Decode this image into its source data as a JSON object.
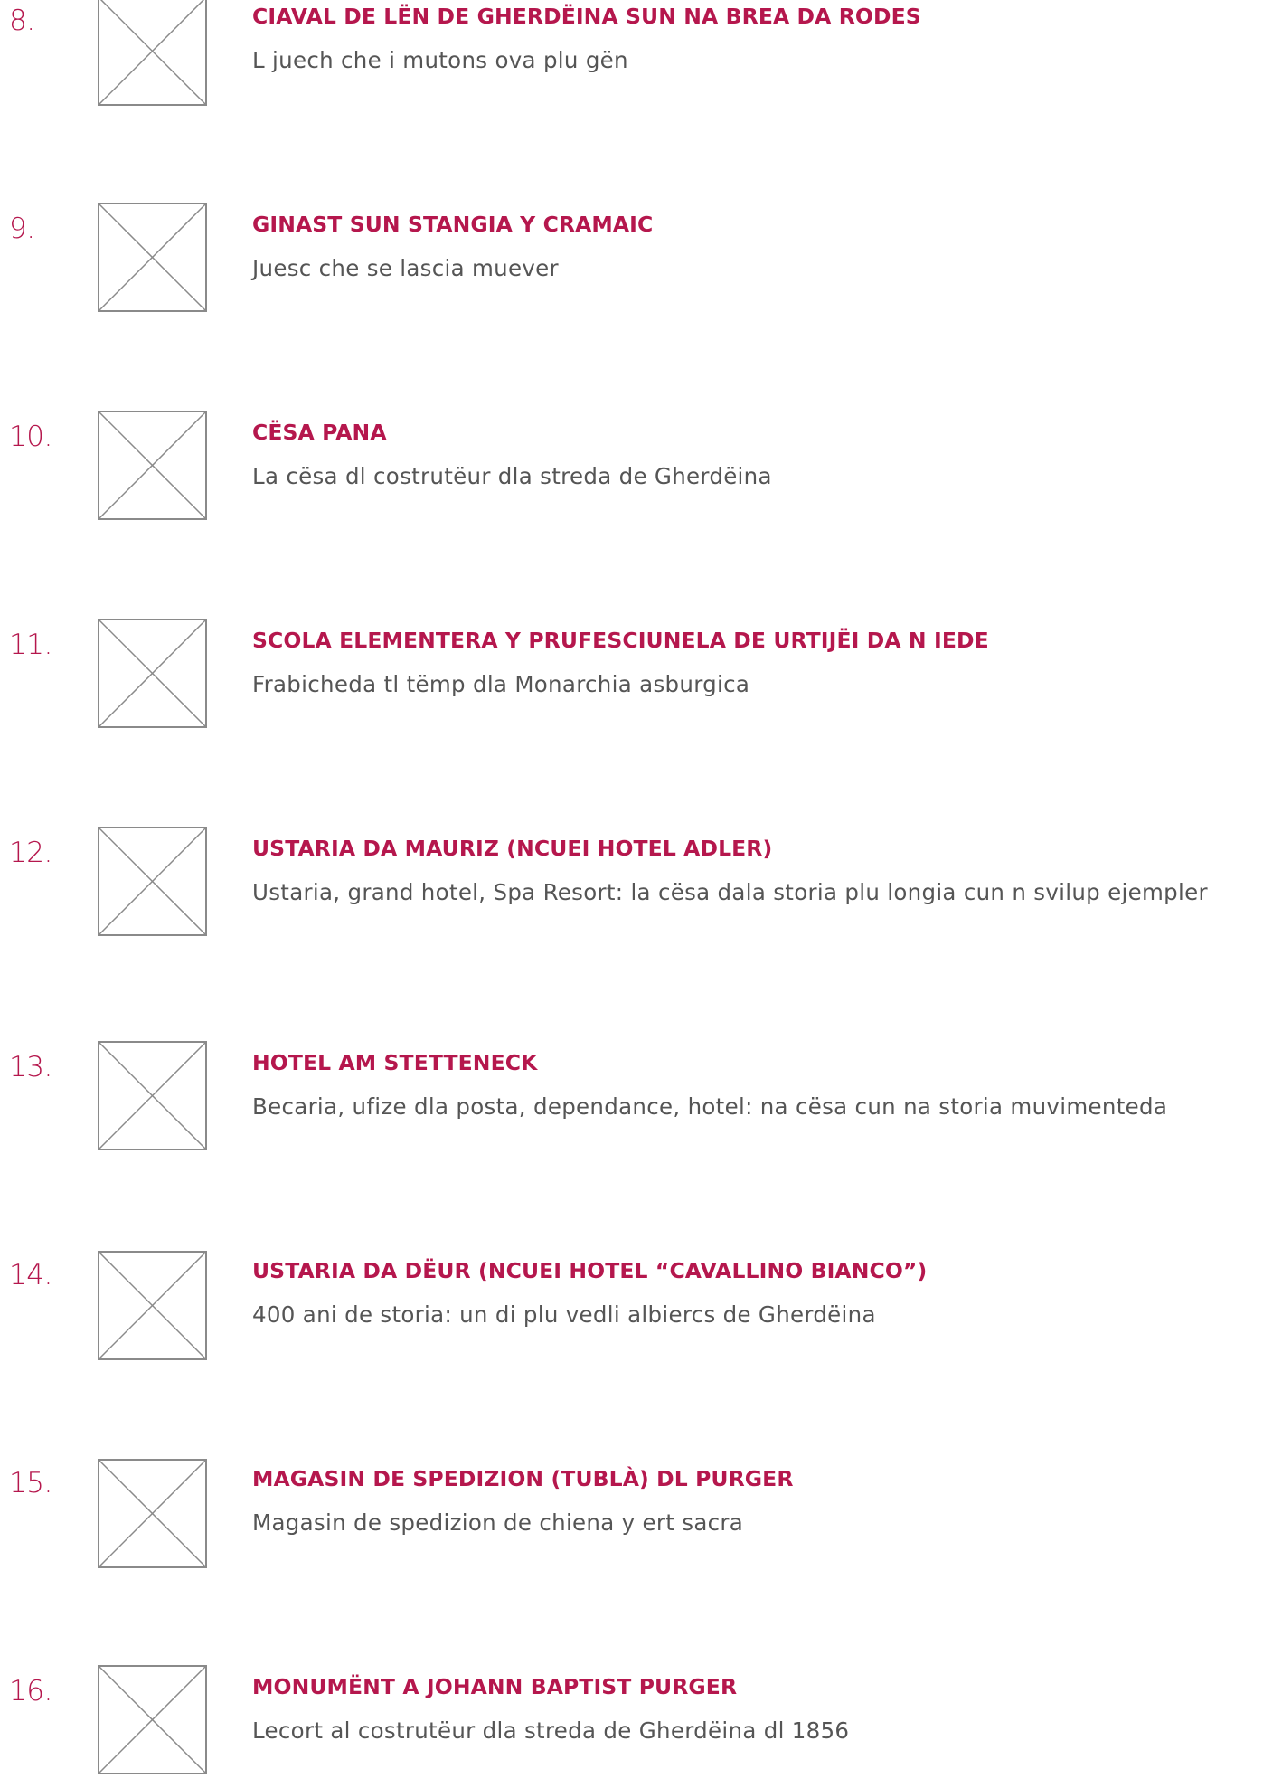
{
  "items": [
    {
      "number": "8.",
      "title": "CIAVAL DE LËN DE GHERDËINA SUN NA BREA DA RODES",
      "description": "L juech che i mutons ova plu gën"
    },
    {
      "number": "9.",
      "title": "GINAST SUN STANGIA Y CRAMAIC",
      "description": "Juesc che se lascia muever"
    },
    {
      "number": "10.",
      "title": "CËSA PANA",
      "description": "La cësa dl costrutëur dla streda de Gherdëina"
    },
    {
      "number": "11.",
      "title": "SCOLA ELEMENTERA Y PRUFESCIUNELA DE URTIJËI DA N IEDE",
      "description": "Frabicheda tl tëmp dla Monarchia asburgica"
    },
    {
      "number": "12.",
      "title": "USTARIA DA MAURIZ (NCUEI HOTEL ADLER)",
      "description": "Ustaria, grand hotel, Spa Resort: la cësa dala storia plu longia cun n svilup ejempler"
    },
    {
      "number": "13.",
      "title": "HOTEL AM STETTENECK",
      "description": "Becaria, ufize dla posta, dependance, hotel: na cësa cun na storia muvimenteda"
    },
    {
      "number": "14.",
      "title": "USTARIA DA DËUR (NCUEI HOTEL “CAVALLINO BIANCO”)",
      "description": "400 ani de storia: un di plu vedli albiercs de Gherdëina"
    },
    {
      "number": "15.",
      "title": "MAGASIN DE SPEDIZION (TUBLÀ) DL PURGER",
      "description": "Magasin de spedizion de chiena y ert sacra"
    },
    {
      "number": "16.",
      "title": "MONUMËNT A JOHANN BAPTIST PURGER",
      "description": "Lecort al costrutëur dla streda de Gherdëina dl 1856"
    }
  ],
  "colors": {
    "accent": "#b5174d",
    "text": "#555555",
    "placeholder_stroke": "#8a8a8a"
  },
  "icons": {
    "thumbnail": "image-placeholder-icon"
  }
}
